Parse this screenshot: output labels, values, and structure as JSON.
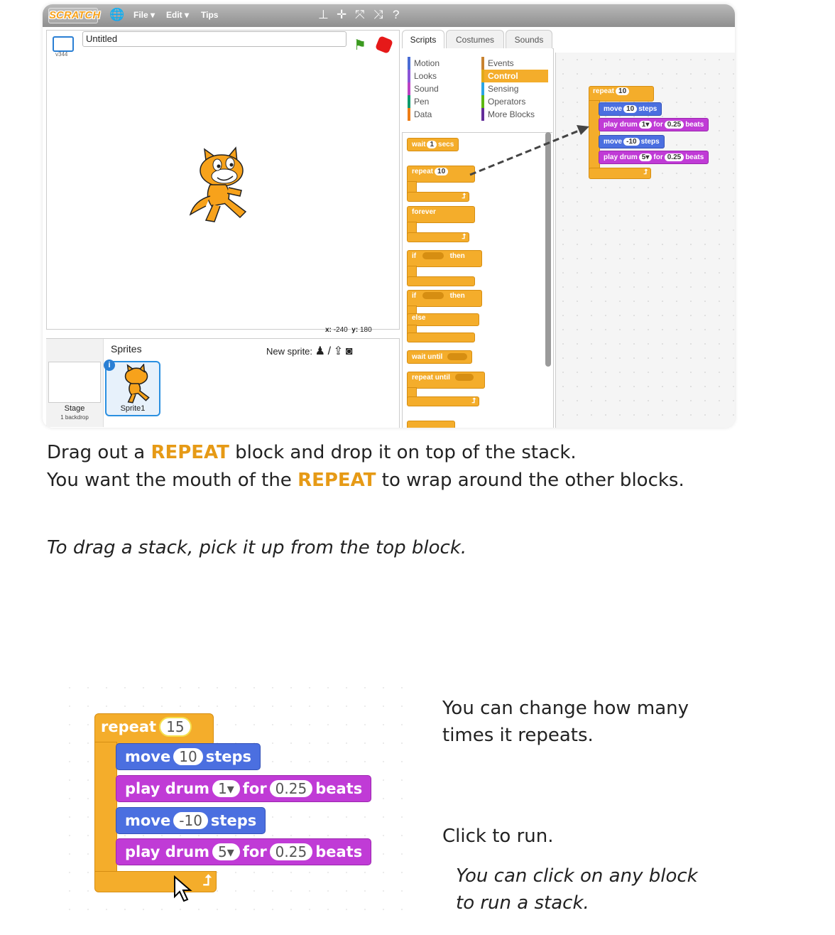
{
  "menubar": {
    "logo": "SCRATCH",
    "file": "File ▾",
    "edit": "Edit ▾",
    "tips": "Tips",
    "tool_icons": [
      "duplicate-icon",
      "delete-icon",
      "grow-icon",
      "shrink-icon",
      "help-icon"
    ]
  },
  "stage": {
    "project_title": "Untitled",
    "version": "v344",
    "coords_x_label": "x:",
    "coords_x": "-240",
    "coords_y_label": "y:",
    "coords_y": "180"
  },
  "sprites": {
    "header": "Sprites",
    "new_sprite": "New sprite:",
    "stage_label": "Stage",
    "backdrop_count": "1 backdrop",
    "sprite_name": "Sprite1",
    "info": "i"
  },
  "tabs": {
    "scripts": "Scripts",
    "costumes": "Costumes",
    "sounds": "Sounds"
  },
  "categories": {
    "left": [
      {
        "label": "Motion",
        "color": "#4a6cd4"
      },
      {
        "label": "Looks",
        "color": "#8a55d7"
      },
      {
        "label": "Sound",
        "color": "#bb42c3"
      },
      {
        "label": "Pen",
        "color": "#0e9a6c"
      },
      {
        "label": "Data",
        "color": "#ee7d16"
      }
    ],
    "right": [
      {
        "label": "Events",
        "color": "#c88330"
      },
      {
        "label": "Control",
        "color": "#e1a91a"
      },
      {
        "label": "Sensing",
        "color": "#2ca5e2"
      },
      {
        "label": "Operators",
        "color": "#5cb712"
      },
      {
        "label": "More Blocks",
        "color": "#632d99"
      }
    ]
  },
  "palette": {
    "wait": "wait",
    "wait_val": "1",
    "wait_unit": "secs",
    "repeat": "repeat",
    "repeat_val": "10",
    "forever": "forever",
    "if": "if",
    "then": "then",
    "if2": "if",
    "then2": "then",
    "else": "else",
    "wait_until": "wait until",
    "repeat_until": "repeat until"
  },
  "script": {
    "repeat": "repeat",
    "repeat_val": "10",
    "move1": "move",
    "move1_val": "10",
    "steps1": "steps",
    "drum1": "play drum",
    "drum1_val": "1▾",
    "for1": "for",
    "beats1_val": "0.25",
    "beats1": "beats",
    "move2": "move",
    "move2_val": "-10",
    "steps2": "steps",
    "drum2": "play drum",
    "drum2_val": "5▾",
    "for2": "for",
    "beats2_val": "0.25",
    "beats2": "beats"
  },
  "instructions": {
    "line1_a": "Drag out a ",
    "line1_hl": "REPEAT",
    "line1_b": " block and drop it on top of the stack.",
    "line2_a": "You want the mouth of the ",
    "line2_hl": "REPEAT",
    "line2_b": " to wrap around the other blocks.",
    "tip": "To drag a stack, pick it up from the top block."
  },
  "big_stack": {
    "repeat": "repeat",
    "repeat_val": "15",
    "move1": "move",
    "move1_val": "10",
    "steps1": "steps",
    "drum1": "play drum",
    "drum1_val": "1▾",
    "for1": "for",
    "beats1_val": "0.25",
    "beats1": "beats",
    "move2": "move",
    "move2_val": "-10",
    "steps2": "steps",
    "drum2": "play drum",
    "drum2_val": "5▾",
    "for2": "for",
    "beats2_val": "0.25",
    "beats2": "beats"
  },
  "side_notes": {
    "change_line1": "You can change how many",
    "change_line2": "times it repeats.",
    "click": "Click to run.",
    "tip_line1": "You can click on any block",
    "tip_line2": "to run a stack."
  }
}
